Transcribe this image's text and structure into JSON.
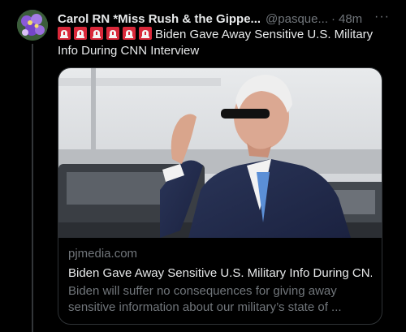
{
  "author": {
    "display_name": "Carol RN *Miss Rush & the Gippe...",
    "handle": "@pasque...",
    "separator": "·",
    "time": "48m"
  },
  "more_label": "···",
  "tweet": {
    "emoji_count": 6,
    "emoji_icon": "rotating-light-icon",
    "text": "Biden Gave Away Sensitive U.S. Military Info During CNN Interview"
  },
  "card": {
    "image_icon": "man-saluting-photo",
    "domain": "pjmedia.com",
    "title": "Biden Gave Away Sensitive U.S. Military Info During CN...",
    "description": "Biden will suffer no consequences for giving away sensitive information about our military’s state of ..."
  },
  "colors": {
    "background": "#000000",
    "primary_text": "#e7e9ea",
    "secondary_text": "#71767b",
    "border": "#2f3336"
  }
}
